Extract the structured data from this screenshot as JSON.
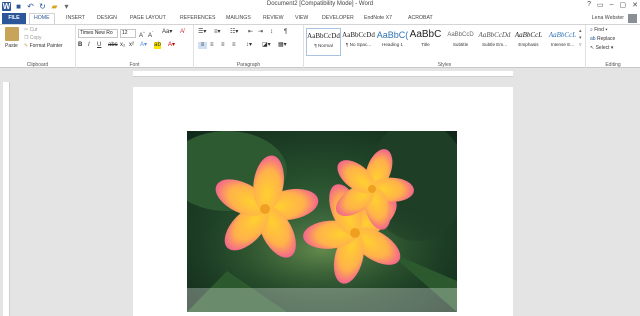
{
  "window": {
    "title": "Document2 [Compatibility Mode] - Word",
    "controls": [
      "?",
      "▭",
      "–",
      "▢",
      "✕"
    ]
  },
  "tabs": [
    "FILE",
    "HOME",
    "INSERT",
    "DESIGN",
    "PAGE LAYOUT",
    "REFERENCES",
    "MAILINGS",
    "REVIEW",
    "VIEW",
    "DEVELOPER",
    "EndNote X7",
    "ACROBAT"
  ],
  "user": "Lena Webster",
  "clipboard": {
    "paste": "Paste",
    "cut": "Cut",
    "copy": "Copy",
    "format_painter": "Format Painter",
    "label": "Clipboard"
  },
  "font": {
    "name": "Times New Ro",
    "size": "12",
    "label": "Font"
  },
  "paragraph": {
    "label": "Paragraph"
  },
  "styles": {
    "label": "Styles",
    "items": [
      {
        "preview": "AaBbCcDd",
        "name": "¶ Normal"
      },
      {
        "preview": "AaBbCcDd",
        "name": "¶ No Spac..."
      },
      {
        "preview": "AaBbC(",
        "name": "Heading 1"
      },
      {
        "preview": "AaBbC",
        "name": "Title"
      },
      {
        "preview": "AaBbCcD",
        "name": "Subtitle"
      },
      {
        "preview": "AaBbCcDd",
        "name": "Subtle Em..."
      },
      {
        "preview": "AaBbCcL",
        "name": "Emphasis"
      },
      {
        "preview": "AaBbCcL",
        "name": "Intense E..."
      }
    ]
  },
  "editing": {
    "find": "Find",
    "replace": "Replace",
    "select": "Select",
    "label": "Editing"
  }
}
